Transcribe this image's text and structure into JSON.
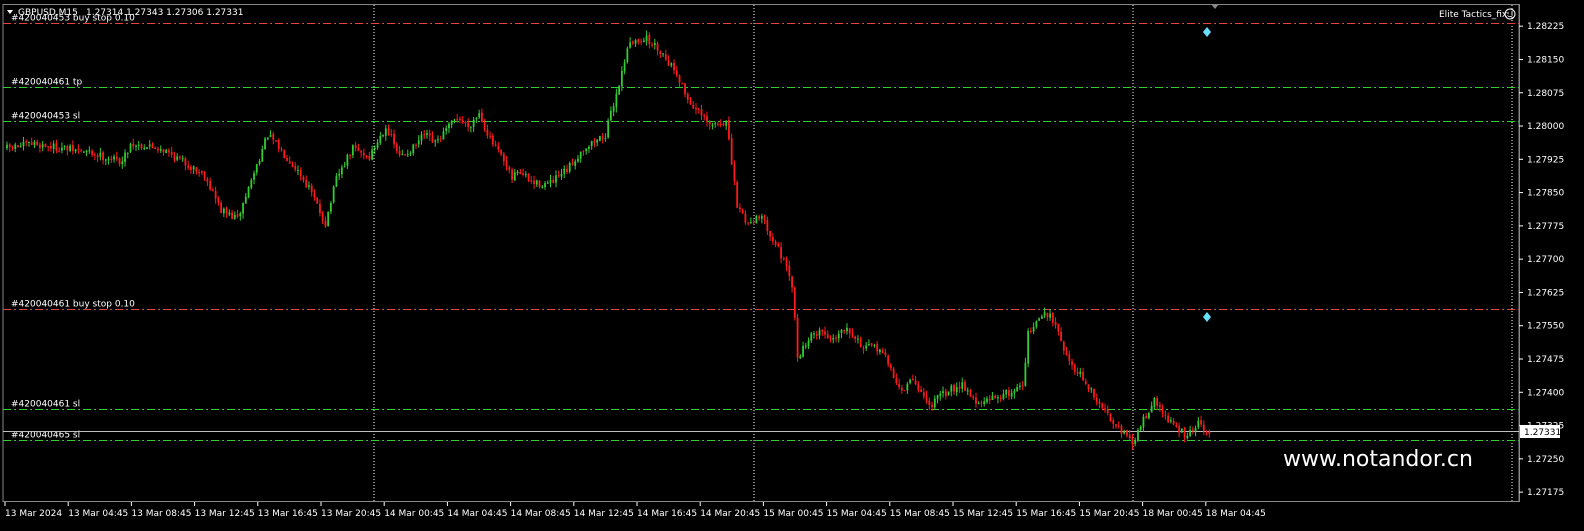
{
  "header": {
    "symbol": "GBPUSD,M15",
    "ohlc": "1.27314 1.27343 1.27306 1.27331",
    "indicator": "Elite Tactics_fix"
  },
  "watermark": "www.notandor.cn",
  "colors": {
    "background": "#000000",
    "bull": "#33cc33",
    "bear": "#ff1a1a",
    "grid": "#ffffff",
    "order_pending": "#e0473a",
    "order_tp_sl": "#33cc33",
    "bid_line": "#c0c0c0",
    "marker": "#66e0ff"
  },
  "price_axis": {
    "ticks": [
      "1.28225",
      "1.28150",
      "1.28075",
      "1.28000",
      "1.27925",
      "1.27850",
      "1.27775",
      "1.27700",
      "1.27625",
      "1.27550",
      "1.27475",
      "1.27400",
      "1.27325",
      "1.27250",
      "1.27175"
    ],
    "current_price": "1.27331"
  },
  "time_axis": {
    "ticks": [
      "13 Mar 2024",
      "13 Mar 04:45",
      "13 Mar 08:45",
      "13 Mar 12:45",
      "13 Mar 16:45",
      "13 Mar 20:45",
      "14 Mar 00:45",
      "14 Mar 04:45",
      "14 Mar 08:45",
      "14 Mar 12:45",
      "14 Mar 16:45",
      "14 Mar 20:45",
      "15 Mar 00:45",
      "15 Mar 04:45",
      "15 Mar 08:45",
      "15 Mar 12:45",
      "15 Mar 16:45",
      "15 Mar 20:45",
      "18 Mar 00:45",
      "18 Mar 04:45"
    ]
  },
  "order_lines": [
    {
      "label": "#420040453 buy stop 0.10",
      "price": 1.28232,
      "kind": "pending"
    },
    {
      "label": "#420040461 tp",
      "price": 1.28088,
      "kind": "tp"
    },
    {
      "label": "#420040453 sl",
      "price": 1.28011,
      "kind": "sl"
    },
    {
      "label": "#420040461 buy stop 0.10",
      "price": 1.27587,
      "kind": "pending"
    },
    {
      "label": "#420040461 sl",
      "price": 1.27363,
      "kind": "sl"
    },
    {
      "label": "#420040465 sl",
      "price": 1.27293,
      "kind": "sl"
    }
  ],
  "chart_data": {
    "type": "candlestick",
    "symbol": "GBPUSD",
    "timeframe": "M15",
    "ylim": [
      1.27155,
      1.28275
    ],
    "grid": "vertical-only",
    "close_path": [
      [
        0,
        1.2795
      ],
      [
        10,
        1.2796
      ],
      [
        20,
        1.2795
      ],
      [
        30,
        1.2794
      ],
      [
        42,
        1.2792
      ],
      [
        45,
        1.2796
      ],
      [
        56,
        1.2795
      ],
      [
        64,
        1.2792
      ],
      [
        72,
        1.2789
      ],
      [
        78,
        1.2781
      ],
      [
        84,
        1.2779
      ],
      [
        88,
        1.2786
      ],
      [
        92,
        1.2793
      ],
      [
        95,
        1.2798
      ],
      [
        102,
        1.2793
      ],
      [
        106,
        1.279
      ],
      [
        110,
        1.2786
      ],
      [
        116,
        1.2778
      ],
      [
        120,
        1.2788
      ],
      [
        126,
        1.2795
      ],
      [
        132,
        1.2793
      ],
      [
        138,
        1.28
      ],
      [
        143,
        1.2793
      ],
      [
        148,
        1.2795
      ],
      [
        152,
        1.2798
      ],
      [
        156,
        1.2796
      ],
      [
        160,
        1.2799
      ],
      [
        164,
        1.2802
      ],
      [
        168,
        1.28
      ],
      [
        172,
        1.2803
      ],
      [
        176,
        1.2797
      ],
      [
        180,
        1.2793
      ],
      [
        184,
        1.2788
      ],
      [
        186,
        1.279
      ],
      [
        192,
        1.2787
      ],
      [
        198,
        1.2787
      ],
      [
        204,
        1.279
      ],
      [
        210,
        1.2795
      ],
      [
        218,
        1.2798
      ],
      [
        224,
        1.2812
      ],
      [
        226,
        1.2818
      ],
      [
        232,
        1.282
      ],
      [
        238,
        1.2817
      ],
      [
        244,
        1.2812
      ],
      [
        248,
        1.2806
      ],
      [
        252,
        1.2803
      ],
      [
        256,
        1.28
      ],
      [
        262,
        1.2801
      ],
      [
        266,
        1.2782
      ],
      [
        270,
        1.2778
      ],
      [
        274,
        1.278
      ],
      [
        278,
        1.2776
      ],
      [
        282,
        1.2771
      ],
      [
        286,
        1.2764
      ],
      [
        288,
        1.2748
      ],
      [
        292,
        1.2752
      ],
      [
        296,
        1.2754
      ],
      [
        300,
        1.2752
      ],
      [
        306,
        1.2755
      ],
      [
        312,
        1.275
      ],
      [
        318,
        1.275
      ],
      [
        326,
        1.274
      ],
      [
        330,
        1.2743
      ],
      [
        336,
        1.2737
      ],
      [
        342,
        1.274
      ],
      [
        348,
        1.2742
      ],
      [
        354,
        1.2737
      ],
      [
        360,
        1.2739
      ],
      [
        366,
        1.274
      ],
      [
        370,
        1.2742
      ],
      [
        372,
        1.2753
      ],
      [
        378,
        1.2758
      ],
      [
        382,
        1.2756
      ],
      [
        386,
        1.2748
      ],
      [
        392,
        1.2743
      ],
      [
        398,
        1.2737
      ],
      [
        404,
        1.2733
      ],
      [
        408,
        1.273
      ],
      [
        410,
        1.2728
      ],
      [
        414,
        1.2734
      ],
      [
        418,
        1.2738
      ],
      [
        424,
        1.2733
      ],
      [
        430,
        1.273
      ],
      [
        434,
        1.2733
      ],
      [
        438,
        1.273
      ]
    ]
  }
}
